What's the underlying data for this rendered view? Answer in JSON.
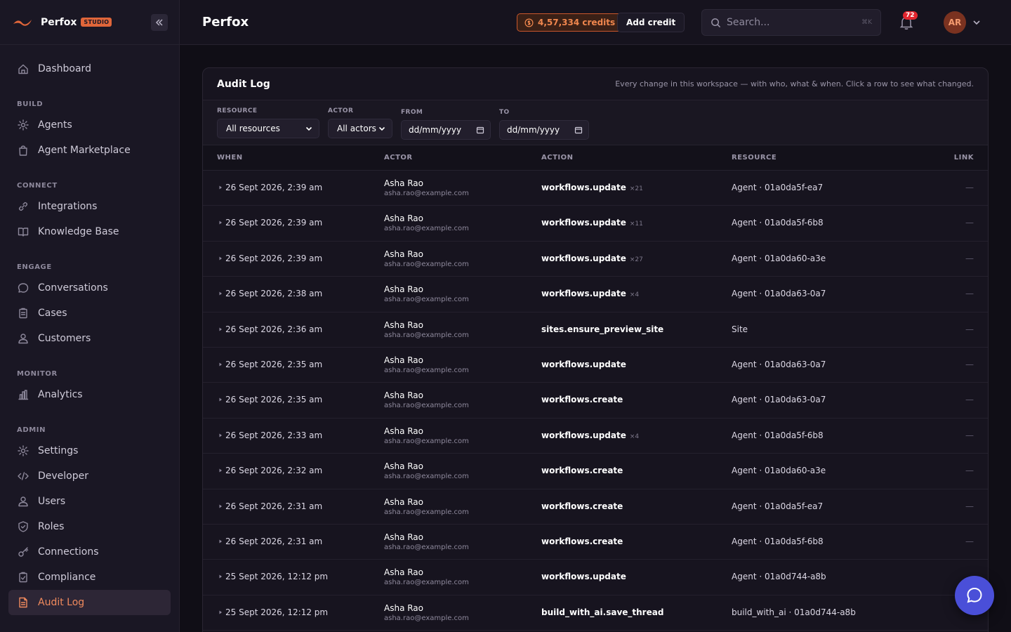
{
  "brand": {
    "name": "Perfox",
    "badge": "STUDIO"
  },
  "sidebar": {
    "top_items": [
      {
        "label": "Dashboard",
        "icon": "home-icon"
      }
    ],
    "sections": [
      {
        "title": "BUILD",
        "items": [
          {
            "label": "Agents",
            "icon": "gear-icon"
          },
          {
            "label": "Agent Marketplace",
            "icon": "shopping-bag-icon"
          }
        ]
      },
      {
        "title": "CONNECT",
        "items": [
          {
            "label": "Integrations",
            "icon": "link-icon"
          },
          {
            "label": "Knowledge Base",
            "icon": "book-icon"
          }
        ]
      },
      {
        "title": "ENGAGE",
        "items": [
          {
            "label": "Conversations",
            "icon": "chat-icon"
          },
          {
            "label": "Cases",
            "icon": "clipboard-icon"
          },
          {
            "label": "Customers",
            "icon": "user-icon"
          }
        ]
      },
      {
        "title": "MONITOR",
        "items": [
          {
            "label": "Analytics",
            "icon": "bar-chart-icon"
          }
        ]
      },
      {
        "title": "ADMIN",
        "items": [
          {
            "label": "Settings",
            "icon": "gear-icon"
          },
          {
            "label": "Developer",
            "icon": "code-icon"
          },
          {
            "label": "Users",
            "icon": "user-icon"
          },
          {
            "label": "Roles",
            "icon": "shield-icon"
          },
          {
            "label": "Connections",
            "icon": "key-icon"
          },
          {
            "label": "Compliance",
            "icon": "clipboard-check-icon"
          },
          {
            "label": "Audit Log",
            "icon": "document-icon",
            "active": true
          }
        ]
      }
    ]
  },
  "header": {
    "title": "Perfox",
    "credits": "4,57,334 credits",
    "add_credit": "Add credit",
    "search_placeholder": "Search...",
    "search_shortcut": "⌘K",
    "notification_count": "72",
    "avatar_initials": "AR"
  },
  "card": {
    "title": "Audit Log",
    "subtitle": "Every change in this workspace — with who, what & when. Click a row to see what changed."
  },
  "filters": {
    "resource": {
      "label": "RESOURCE",
      "value": "All resources"
    },
    "actor": {
      "label": "ACTOR",
      "value": "All actors"
    },
    "from": {
      "label": "FROM",
      "value": "dd/mm/yyyy"
    },
    "to": {
      "label": "TO",
      "value": "dd/mm/yyyy"
    }
  },
  "table": {
    "columns": {
      "when": "WHEN",
      "actor": "ACTOR",
      "action": "ACTION",
      "resource": "RESOURCE",
      "link": "LINK"
    },
    "rows": [
      {
        "when": "26 Sept 2026, 2:39 am",
        "actor": "Asha Rao",
        "email": "asha.rao@example.com",
        "action": "workflows.update",
        "count": "×21",
        "resource": "Agent · 01a0da5f-ea7",
        "link": "—"
      },
      {
        "when": "26 Sept 2026, 2:39 am",
        "actor": "Asha Rao",
        "email": "asha.rao@example.com",
        "action": "workflows.update",
        "count": "×11",
        "resource": "Agent · 01a0da5f-6b8",
        "link": "—"
      },
      {
        "when": "26 Sept 2026, 2:39 am",
        "actor": "Asha Rao",
        "email": "asha.rao@example.com",
        "action": "workflows.update",
        "count": "×27",
        "resource": "Agent · 01a0da60-a3e",
        "link": "—"
      },
      {
        "when": "26 Sept 2026, 2:38 am",
        "actor": "Asha Rao",
        "email": "asha.rao@example.com",
        "action": "workflows.update",
        "count": "×4",
        "resource": "Agent · 01a0da63-0a7",
        "link": "—"
      },
      {
        "when": "26 Sept 2026, 2:36 am",
        "actor": "Asha Rao",
        "email": "asha.rao@example.com",
        "action": "sites.ensure_preview_site",
        "count": "",
        "resource": "Site",
        "link": "—"
      },
      {
        "when": "26 Sept 2026, 2:35 am",
        "actor": "Asha Rao",
        "email": "asha.rao@example.com",
        "action": "workflows.update",
        "count": "",
        "resource": "Agent · 01a0da63-0a7",
        "link": "—"
      },
      {
        "when": "26 Sept 2026, 2:35 am",
        "actor": "Asha Rao",
        "email": "asha.rao@example.com",
        "action": "workflows.create",
        "count": "",
        "resource": "Agent · 01a0da63-0a7",
        "link": "—"
      },
      {
        "when": "26 Sept 2026, 2:33 am",
        "actor": "Asha Rao",
        "email": "asha.rao@example.com",
        "action": "workflows.update",
        "count": "×4",
        "resource": "Agent · 01a0da5f-6b8",
        "link": "—"
      },
      {
        "when": "26 Sept 2026, 2:32 am",
        "actor": "Asha Rao",
        "email": "asha.rao@example.com",
        "action": "workflows.create",
        "count": "",
        "resource": "Agent · 01a0da60-a3e",
        "link": "—"
      },
      {
        "when": "26 Sept 2026, 2:31 am",
        "actor": "Asha Rao",
        "email": "asha.rao@example.com",
        "action": "workflows.create",
        "count": "",
        "resource": "Agent · 01a0da5f-ea7",
        "link": "—"
      },
      {
        "when": "26 Sept 2026, 2:31 am",
        "actor": "Asha Rao",
        "email": "asha.rao@example.com",
        "action": "workflows.create",
        "count": "",
        "resource": "Agent · 01a0da5f-6b8",
        "link": "—"
      },
      {
        "when": "25 Sept 2026, 12:12 pm",
        "actor": "Asha Rao",
        "email": "asha.rao@example.com",
        "action": "workflows.update",
        "count": "",
        "resource": "Agent · 01a0d744-a8b",
        "link": ""
      },
      {
        "when": "25 Sept 2026, 12:12 pm",
        "actor": "Asha Rao",
        "email": "asha.rao@example.com",
        "action": "build_with_ai.save_thread",
        "count": "",
        "resource": "build_with_ai · 01a0d744-a8b",
        "link": ""
      }
    ]
  },
  "colors": {
    "accent": "#f08a5d",
    "fab": "#4a4fd8"
  }
}
